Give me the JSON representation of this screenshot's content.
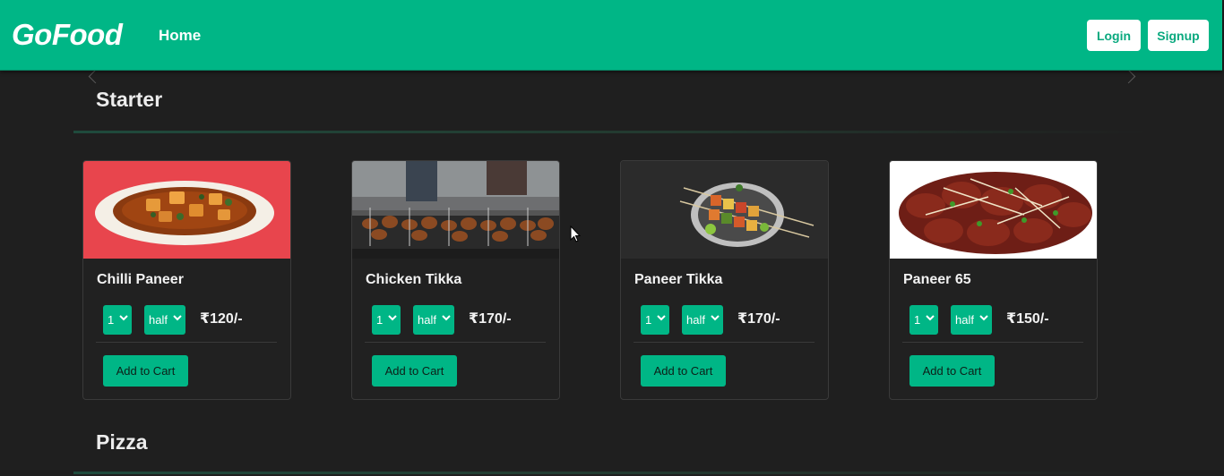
{
  "navbar": {
    "brand": "GoFood",
    "home_label": "Home",
    "login_label": "Login",
    "signup_label": "Signup",
    "accent_color": "#00b686"
  },
  "sections": [
    {
      "title": "Starter",
      "items": [
        {
          "name": "Chilli Paneer",
          "qty": "1",
          "size": "half",
          "price": "₹120/-",
          "cart_label": "Add to Cart",
          "image": "chilli-paneer-photo"
        },
        {
          "name": "Chicken Tikka",
          "qty": "1",
          "size": "half",
          "price": "₹170/-",
          "cart_label": "Add to Cart",
          "image": "chicken-tikka-photo"
        },
        {
          "name": "Paneer Tikka",
          "qty": "1",
          "size": "half",
          "price": "₹170/-",
          "cart_label": "Add to Cart",
          "image": "paneer-tikka-photo"
        },
        {
          "name": "Paneer 65",
          "qty": "1",
          "size": "half",
          "price": "₹150/-",
          "cart_label": "Add to Cart",
          "image": "paneer-65-photo"
        }
      ]
    },
    {
      "title": "Pizza",
      "items": []
    }
  ]
}
